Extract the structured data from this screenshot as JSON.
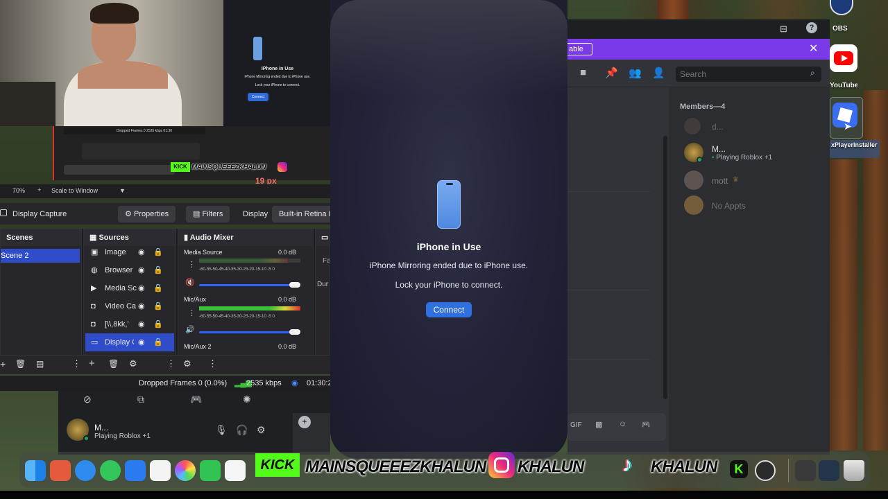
{
  "preview": {
    "title": "iPhone in Use",
    "line1": "iPhone Mirroring ended due to iPhone use.",
    "line2": "Lock your iPhone to connect.",
    "button": "Connect",
    "status_dropped": "Dropped Frames 0",
    "status_kbps": "2535 kbps",
    "status_time": "01:30",
    "kick": "KICK",
    "marquee": "MAINSQUEEEZKHALUN",
    "px_readout": "19 px"
  },
  "obs": {
    "toolbar": {
      "zoom": "70%",
      "scale_mode": "Scale to Window"
    },
    "source_bar": {
      "selected_source": "Display Capture",
      "properties": "Properties",
      "filters": "Filters",
      "display_label": "Display",
      "display_value": "Built-in Retina I"
    },
    "scenes": {
      "title": "Scenes",
      "items": [
        "Scene 2"
      ]
    },
    "sources": {
      "title": "Sources",
      "items": [
        "Image",
        "Browser",
        "Media Sc",
        "Video Ca",
        "[\\\\,8kk,'",
        "Display C"
      ]
    },
    "mixer": {
      "title": "Audio Mixer",
      "ticks": "-60-55-50-45-40-35-30-25-20-15-10 -5  0",
      "channels": [
        {
          "name": "Media Source",
          "db": "0.0 dB"
        },
        {
          "name": "Mic/Aux",
          "db": "0.0 dB"
        },
        {
          "name": "Mic/Aux 2",
          "db": "0.0 dB"
        }
      ]
    },
    "transitions": {
      "fade_label": "Fa",
      "duration_label": "Dur"
    },
    "status": {
      "dropped": "Dropped Frames 0 (0.0%)",
      "kbps": "2535 kbps",
      "time": "01:30:2"
    }
  },
  "voice_panel": {
    "user": "M...",
    "activity": "Playing Roblox +1"
  },
  "iphone": {
    "title": "iPhone in Use",
    "line1": "iPhone Mirroring ended due to iPhone use.",
    "line2": "Lock your iPhone to connect.",
    "button": "Connect"
  },
  "discord": {
    "banner_tag": "able",
    "search_placeholder": "Search",
    "members_header": "Members—4",
    "members": [
      {
        "name": "d...",
        "activity": ""
      },
      {
        "name": "M...",
        "activity": "Playing Roblox +1"
      },
      {
        "name": "mott",
        "activity": ""
      },
      {
        "name": "No Appts",
        "activity": ""
      }
    ]
  },
  "desktop": {
    "icons": [
      {
        "label": "OBS"
      },
      {
        "label": "YouTube"
      },
      {
        "label": "xPlayerInstaller"
      }
    ]
  },
  "dock": {
    "kick": "KICK",
    "marquee1": "MAINSQUEEEZKHALUN",
    "marquee2": "KHALUN",
    "marquee3": "KHALUN"
  },
  "colors": {
    "obs_accent": "#2f4dc9",
    "discord_banner": "#7b3ae8",
    "connect_blue": "#2f6fde",
    "kick_green": "#53fc18"
  }
}
